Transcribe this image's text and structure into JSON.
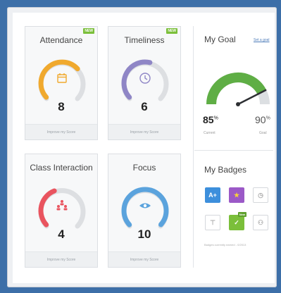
{
  "cards": [
    {
      "title": "Attendance",
      "value": "8",
      "footer": "Improve my Score",
      "new": "NEW",
      "color": "#f0a92e",
      "level": 0.68,
      "icon": "calendar-icon"
    },
    {
      "title": "Timeliness",
      "value": "6",
      "footer": "Improve my Score",
      "new": "NEW",
      "color": "#8f86c6",
      "level": 0.55,
      "icon": "clock-icon"
    },
    {
      "title": "Class Interaction",
      "value": "4",
      "footer": "Improve my Score",
      "new": "",
      "color": "#e9545f",
      "level": 0.42,
      "icon": "people-icon"
    },
    {
      "title": "Focus",
      "value": "10",
      "footer": "Improve my Score",
      "new": "",
      "color": "#5ba3dd",
      "level": 1.0,
      "icon": "eye-icon"
    }
  ],
  "goal": {
    "title": "My Goal",
    "link": "Set a goal",
    "current_value": "85",
    "current_unit": "%",
    "current_label": "Current",
    "goal_value": "90",
    "goal_unit": "%",
    "goal_label": "Goal",
    "gauge_level": 0.85,
    "gauge_color": "#5fae45"
  },
  "badges": {
    "title": "My Badges",
    "note": "Badges currently earned - 0/2013",
    "items": [
      {
        "name": "a-plus-badge",
        "text": "A+",
        "color": "#3d8fdc"
      },
      {
        "name": "star-badge",
        "text": "★",
        "color": "#9b59c7"
      },
      {
        "name": "clock-badge",
        "text": "◷",
        "color": ""
      },
      {
        "name": "trophy-badge",
        "text": "⊤",
        "color": ""
      },
      {
        "name": "check-badge",
        "text": "✓",
        "color": "#7bbf3a",
        "new": "New"
      },
      {
        "name": "people-badge",
        "text": "⚇",
        "color": ""
      }
    ]
  }
}
